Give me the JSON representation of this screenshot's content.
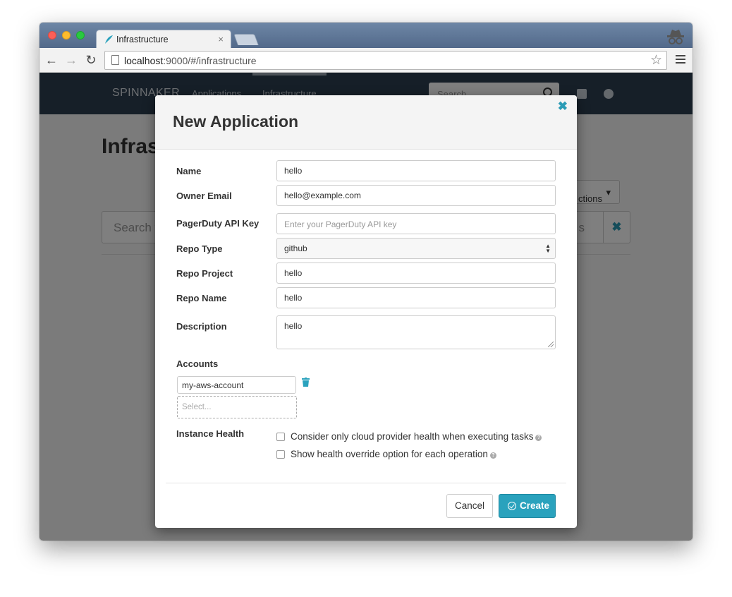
{
  "browser": {
    "tab_title": "Infrastructure",
    "tab_close": "×",
    "url_host": "localhost",
    "url_rest": ":9000/#/infrastructure"
  },
  "app_nav": {
    "brand": "SPINNAKER",
    "links": [
      "Applications",
      "Infrastructure"
    ],
    "search_placeholder": "Search"
  },
  "page": {
    "title": "Infras",
    "actions_label": "ctions",
    "filter_placeholder": "Search t",
    "filter_placeholder_tail": "s"
  },
  "modal": {
    "title": "New Application",
    "close": "✖",
    "fields": {
      "name": {
        "label": "Name",
        "value": "hello"
      },
      "owner_email": {
        "label": "Owner Email",
        "value": "hello@example.com"
      },
      "pagerduty": {
        "label": "PagerDuty API Key",
        "placeholder": "Enter your PagerDuty API key"
      },
      "repo_type": {
        "label": "Repo Type",
        "value": "github"
      },
      "repo_project": {
        "label": "Repo Project",
        "value": "hello"
      },
      "repo_name": {
        "label": "Repo Name",
        "value": "hello"
      },
      "description": {
        "label": "Description",
        "value": "hello"
      }
    },
    "accounts": {
      "label": "Accounts",
      "selected": "my-aws-account",
      "select_placeholder": "Select..."
    },
    "instance_health": {
      "label": "Instance Health",
      "options": [
        {
          "label": "Consider only cloud provider health when executing tasks",
          "checked": false
        },
        {
          "label": "Show health override option for each operation",
          "checked": false
        }
      ]
    },
    "buttons": {
      "cancel": "Cancel",
      "create": "Create"
    }
  },
  "colors": {
    "accent": "#2aa2bd",
    "navbar": "#2d3e50"
  }
}
